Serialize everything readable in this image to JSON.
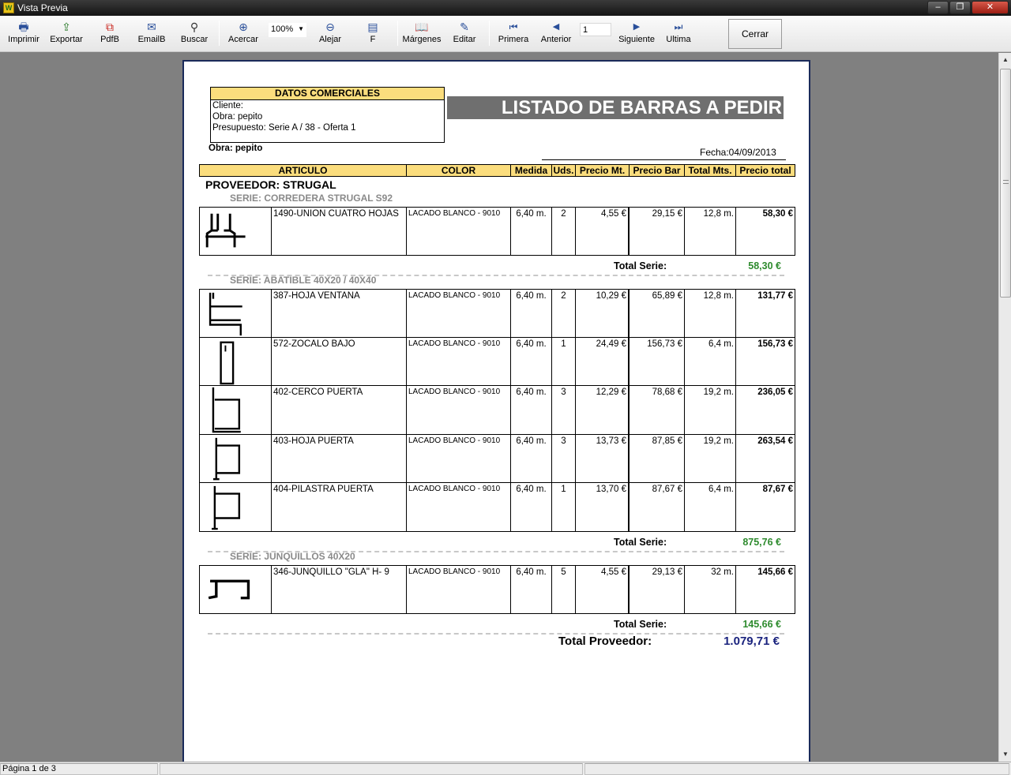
{
  "window": {
    "title": "Vista Previa",
    "minimize": "–",
    "maximize": "❐",
    "close": "✕"
  },
  "toolbar": {
    "print": "Imprimir",
    "export": "Exportar",
    "pdf": "PdfB",
    "email": "EmailB",
    "search": "Buscar",
    "zoom_in": "Acercar",
    "zoom_value": "100%",
    "zoom_out": "Alejar",
    "fit": "F",
    "margins": "Márgenes",
    "edit": "Editar",
    "first": "Primera",
    "previous": "Anterior",
    "page": "1",
    "next": "Siguiente",
    "last": "Ultima",
    "close": "Cerrar"
  },
  "report": {
    "datos_header": "DATOS COMERCIALES",
    "cliente": "Cliente:",
    "obra_box": "Obra: pepito",
    "presupuesto": "Presupuesto: Serie A / 38 - Oferta 1",
    "title": "LISTADO DE BARRAS A PEDIR",
    "obra": "Obra: pepito",
    "fecha": "Fecha:04/09/2013",
    "columns": [
      "ARTICULO",
      "COLOR",
      "Medida",
      "Uds.",
      "Precio Mt.",
      "Precio Bar",
      "Total Mts.",
      "Precio total"
    ],
    "proveedor": "PROVEEDOR: STRUGAL",
    "series": [
      {
        "name": "SERIE: CORREDERA STRUGAL  S92",
        "items": [
          {
            "articulo": "1490-UNION CUATRO HOJAS",
            "color": "LACADO BLANCO - 9010",
            "medida": "6,40 m.",
            "uds": "2",
            "precio_mt": "4,55 €",
            "precio_bar": "29,15 €",
            "total_mts": "12,8 m.",
            "precio_total": "58,30 €",
            "profile": "union"
          }
        ],
        "total_label": "Total Serie:",
        "total": "58,30 €"
      },
      {
        "name": "SERIE: ABATIBLE 40X20 / 40X40",
        "items": [
          {
            "articulo": "387-HOJA VENTANA",
            "color": "LACADO BLANCO - 9010",
            "medida": "6,40 m.",
            "uds": "2",
            "precio_mt": "10,29 €",
            "precio_bar": "65,89 €",
            "total_mts": "12,8 m.",
            "precio_total": "131,77 €",
            "profile": "hoja"
          },
          {
            "articulo": "572-ZOCALO BAJO",
            "color": "LACADO BLANCO - 9010",
            "medida": "6,40 m.",
            "uds": "1",
            "precio_mt": "24,49 €",
            "precio_bar": "156,73 €",
            "total_mts": "6,4 m.",
            "precio_total": "156,73 €",
            "profile": "zocalo"
          },
          {
            "articulo": "402-CERCO PUERTA",
            "color": "LACADO BLANCO - 9010",
            "medida": "6,40 m.",
            "uds": "3",
            "precio_mt": "12,29 €",
            "precio_bar": "78,68 €",
            "total_mts": "19,2 m.",
            "precio_total": "236,05 €",
            "profile": "cerco"
          },
          {
            "articulo": "403-HOJA PUERTA",
            "color": "LACADO BLANCO - 9010",
            "medida": "6,40 m.",
            "uds": "3",
            "precio_mt": "13,73 €",
            "precio_bar": "87,85 €",
            "total_mts": "19,2 m.",
            "precio_total": "263,54 €",
            "profile": "hojapuerta"
          },
          {
            "articulo": "404-PILASTRA PUERTA",
            "color": "LACADO BLANCO - 9010",
            "medida": "6,40 m.",
            "uds": "1",
            "precio_mt": "13,70 €",
            "precio_bar": "87,67 €",
            "total_mts": "6,4 m.",
            "precio_total": "87,67 €",
            "profile": "pilastra"
          }
        ],
        "total_label": "Total Serie:",
        "total": "875,76 €"
      },
      {
        "name": "SERIE: JUNQUILLOS 40X20",
        "items": [
          {
            "articulo": "346-JUNQUILLO \"GLA\" H- 9",
            "color": "LACADO BLANCO - 9010",
            "medida": "6,40 m.",
            "uds": "5",
            "precio_mt": "4,55 €",
            "precio_bar": "29,13 €",
            "total_mts": "32 m.",
            "precio_total": "145,66 €",
            "profile": "junquillo"
          }
        ],
        "total_label": "Total Serie:",
        "total": "145,66 €"
      }
    ],
    "total_proveedor_label": "Total Proveedor:",
    "total_proveedor": "1.079,71 €"
  },
  "status": {
    "page_info": "Página 1 de 3"
  },
  "colors": {
    "header_fill": "#fbdd7d",
    "title_fill": "#6f6f6f",
    "serie_total": "#2e8b2e",
    "proveedor_total": "#1a237e"
  }
}
